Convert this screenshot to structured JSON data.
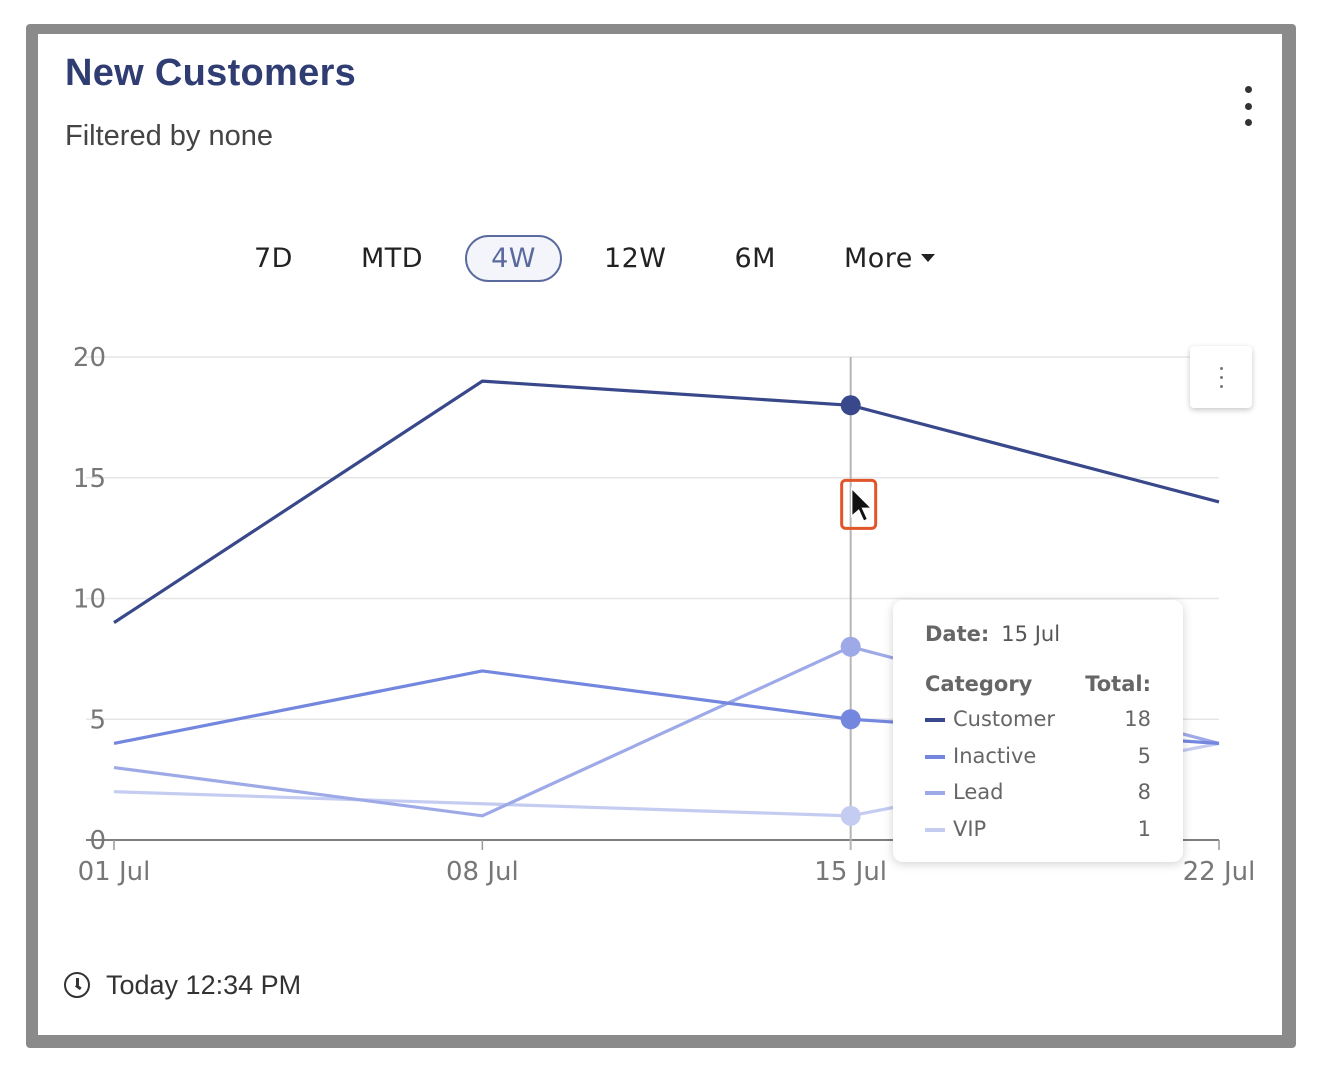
{
  "widget": {
    "title": "New Customers",
    "subtitle": "Filtered by none",
    "menu_icon": "kebab-vertical-icon",
    "last_updated": "Today 12:34 PM"
  },
  "ranges": {
    "items": [
      "7D",
      "MTD",
      "4W",
      "12W",
      "6M"
    ],
    "active": "4W",
    "more_label": "More"
  },
  "colors": {
    "customer": "#38488a",
    "inactive": "#7487df",
    "lead": "#9eaae8",
    "vip": "#c5ccf2",
    "active_range": "#5b6a9e"
  },
  "chart_data": {
    "type": "line",
    "x": [
      "01 Jul",
      "08 Jul",
      "15 Jul",
      "22 Jul"
    ],
    "ylim": [
      0,
      20
    ],
    "yticks": [
      0,
      5,
      10,
      15,
      20
    ],
    "grid": true,
    "series": [
      {
        "name": "Customer",
        "values": [
          9,
          19,
          18,
          14
        ]
      },
      {
        "name": "Inactive",
        "values": [
          4,
          7,
          5,
          4
        ]
      },
      {
        "name": "Lead",
        "values": [
          3,
          1,
          8,
          4
        ]
      },
      {
        "name": "VIP",
        "values": [
          2,
          1.5,
          1,
          4
        ]
      }
    ],
    "highlight_x": "15 Jul"
  },
  "tooltip": {
    "date_label": "Date:",
    "date_value": "15 Jul",
    "category_header": "Category",
    "total_header": "Total:",
    "rows": [
      {
        "label": "Customer",
        "value": "18"
      },
      {
        "label": "Inactive",
        "value": "5"
      },
      {
        "label": "Lead",
        "value": "8"
      },
      {
        "label": "VIP",
        "value": "1"
      }
    ]
  }
}
